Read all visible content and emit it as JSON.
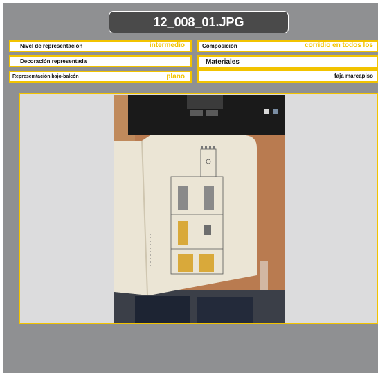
{
  "header": {
    "title": "12_008_01.JPG"
  },
  "fields": {
    "nivel": {
      "label": "Nivel de representación",
      "value": "intermedio"
    },
    "composicion": {
      "label": "Composición",
      "value": "corridio en todos los"
    },
    "decoracion": {
      "label": "Decoración representada"
    },
    "materiales": {
      "label": "Materiales"
    },
    "balcon": {
      "label": "Represemtación bajo-balcón",
      "value": "plano"
    },
    "materiales_value": {
      "value": "faja marcapiso"
    }
  },
  "colors": {
    "accent": "#f2c300",
    "panel": "#8f9092",
    "title_bg": "#4a4a4a"
  }
}
